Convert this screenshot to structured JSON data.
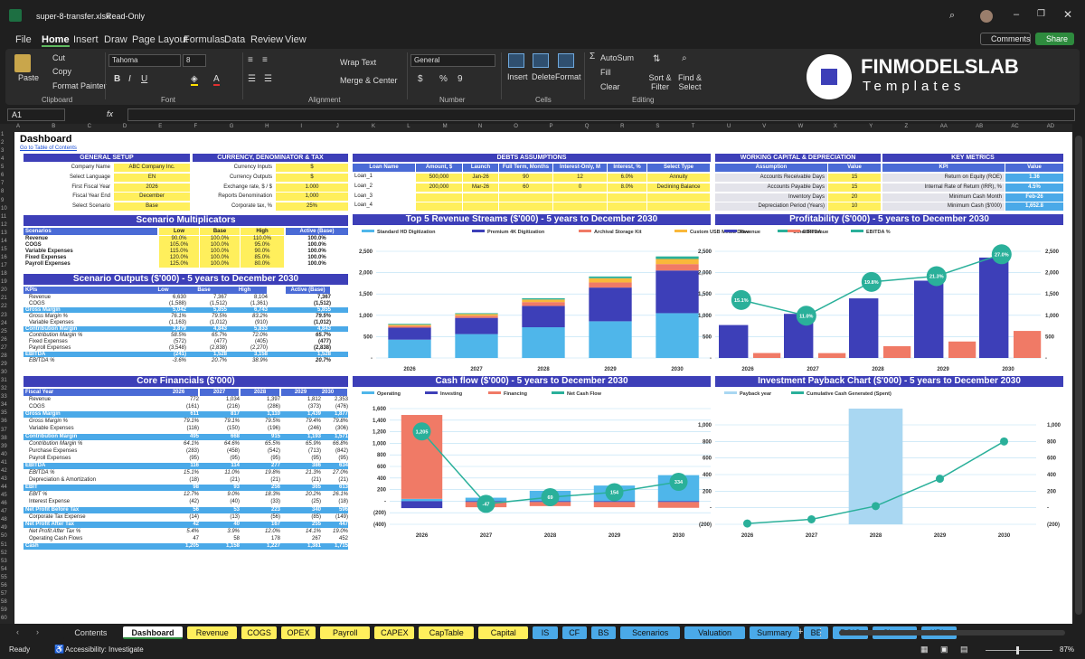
{
  "title": {
    "file": "super-8-transfer.xlsx",
    "mode": "Read-Only"
  },
  "menu": [
    "File",
    "Home",
    "Insert",
    "Draw",
    "Page Layout",
    "Formulas",
    "Data",
    "Review",
    "View"
  ],
  "actions": {
    "comments": "Comments",
    "share": "Share"
  },
  "ribbon": {
    "paste": "Paste",
    "cut": "Cut",
    "copy": "Copy",
    "format_painter": "Format Painter",
    "clipboard": "Clipboard",
    "font_name": "Tahoma",
    "font_size": "8",
    "font": "Font",
    "wrap": "Wrap Text",
    "merge": "Merge & Center",
    "alignment": "Alignment",
    "number_format": "General",
    "number": "Number",
    "insert": "Insert",
    "delete": "Delete",
    "format": "Format",
    "cells": "Cells",
    "autosum": "AutoSum",
    "fill": "Fill",
    "clear": "Clear",
    "sort": "Sort & Filter",
    "find": "Find & Select",
    "editing": "Editing"
  },
  "brand": {
    "name": "FINMODELSLAB",
    "sub": "Templates"
  },
  "formula": {
    "cell": "A1",
    "fx": "fx"
  },
  "columns": [
    "A",
    "B",
    "C",
    "D",
    "E",
    "F",
    "G",
    "H",
    "I",
    "J",
    "K",
    "L",
    "M",
    "N",
    "O",
    "P",
    "Q",
    "R",
    "S",
    "T",
    "U",
    "V",
    "W",
    "X",
    "Y",
    "Z",
    "AA",
    "AB",
    "AC",
    "AD"
  ],
  "sheet": {
    "title": "Dashboard",
    "link": "Go to Table of Contents",
    "general": {
      "header": "GENERAL SETUP",
      "rows": [
        [
          "Company Name",
          "ABC Company Inc."
        ],
        [
          "Select Language",
          "EN"
        ],
        [
          "First Fiscal Year",
          "2026"
        ],
        [
          "Fiscal Year End",
          "December"
        ],
        [
          "Select Scenario",
          "Base"
        ]
      ]
    },
    "currency": {
      "header": "CURRENCY, DENOMINATOR & TAX",
      "rows": [
        [
          "Currency Inputs",
          "$"
        ],
        [
          "Currency Outputs",
          "$"
        ],
        [
          "Exchange rate, $ / $",
          "1.000"
        ],
        [
          "Reports Denomination",
          "1,000"
        ],
        [
          "Corporate tax, %",
          "25%"
        ]
      ]
    },
    "debts": {
      "header": "DEBTS ASSUMPTIONS",
      "cols": [
        "Loan Name",
        "Amount, $",
        "Launch",
        "Full Term, Months",
        "Interest-Only, M",
        "Interest, %",
        "Select Type"
      ],
      "rows": [
        [
          "Loan_1",
          "500,000",
          "Jan-26",
          "90",
          "12",
          "6.0%",
          "Annuity"
        ],
        [
          "Loan_2",
          "200,000",
          "Mar-26",
          "60",
          "0",
          "8.0%",
          "Declining Balance"
        ],
        [
          "Loan_3",
          "",
          "",
          "",
          "",
          "",
          ""
        ],
        [
          "Loan_4",
          "",
          "",
          "",
          "",
          "",
          ""
        ]
      ]
    },
    "wc": {
      "header": "WORKING CAPITAL & DEPRECIATION",
      "cols": [
        "Assumption",
        "Value"
      ],
      "rows": [
        [
          "Accounts Receivable Days",
          "15"
        ],
        [
          "Accounts Payable Days",
          "15"
        ],
        [
          "Inventory Days",
          "20"
        ],
        [
          "Depreciation Period (Years)",
          "10"
        ]
      ]
    },
    "kpi": {
      "header": "KEY METRICS",
      "cols": [
        "KPI",
        "Value"
      ],
      "rows": [
        [
          "Return on Equity (ROE)",
          "1.36"
        ],
        [
          "Internal Rate of Return (IRR), %",
          "4.5%"
        ],
        [
          "Minimum Cash Month",
          "Feb-26"
        ],
        [
          "Minimum Cash ($'000)",
          "1,652.8"
        ]
      ]
    },
    "scenario": {
      "header": "Scenario Multiplicators",
      "cols": [
        "Scenarios",
        "Low",
        "Base",
        "High",
        "Active (Base)"
      ],
      "rows": [
        [
          "Revenue",
          "90.0%",
          "100.0%",
          "110.0%",
          "100.0%"
        ],
        [
          "COGS",
          "105.0%",
          "100.0%",
          "95.0%",
          "100.0%"
        ],
        [
          "Variable Expenses",
          "115.0%",
          "100.0%",
          "90.0%",
          "100.0%"
        ],
        [
          "Fixed Expenses",
          "120.0%",
          "100.0%",
          "85.0%",
          "100.0%"
        ],
        [
          "Payroll Expenses",
          "125.0%",
          "100.0%",
          "80.0%",
          "100.0%"
        ]
      ]
    },
    "outputs": {
      "header": "Scenario Outputs ($'000) - 5 years to December 2030",
      "cols": [
        "KPIs",
        "Low",
        "Base",
        "High",
        "Active (Base)"
      ],
      "rows": [
        [
          "Revenue",
          "6,630",
          "7,367",
          "8,104",
          "7,367",
          "n"
        ],
        [
          "COGS",
          "(1,588)",
          "(1,512)",
          "(1,361)",
          "(1,512)",
          "n"
        ],
        [
          "Gross Margin",
          "5,042",
          "5,855",
          "6,743",
          "5,855",
          "h"
        ],
        [
          "Gross Margin %",
          "76.1%",
          "79.5%",
          "83.2%",
          "79.5%",
          "i"
        ],
        [
          "Variable Expenses",
          "(1,163)",
          "(1,012)",
          "(910)",
          "(1,012)",
          "n"
        ],
        [
          "Contribution Margin",
          "3,879",
          "4,843",
          "5,833",
          "4,843",
          "h"
        ],
        [
          "Contribution Margin %",
          "58.5%",
          "65.7%",
          "72.0%",
          "65.7%",
          "i"
        ],
        [
          "Fixed Expenses",
          "(572)",
          "(477)",
          "(405)",
          "(477)",
          "n"
        ],
        [
          "Payroll Expenses",
          "(3,548)",
          "(2,838)",
          "(2,270)",
          "(2,838)",
          "n"
        ],
        [
          "EBITDA",
          "(241)",
          "1,528",
          "3,158",
          "1,528",
          "h"
        ],
        [
          "EBITDA %",
          "-3.6%",
          "20.7%",
          "38.9%",
          "20.7%",
          "i"
        ]
      ]
    },
    "core": {
      "header": "Core Financials ($'000)",
      "cols": [
        "Fiscal Year",
        "2026",
        "2027",
        "2028",
        "2029",
        "2030"
      ],
      "rows": [
        [
          "Revenue",
          "772",
          "1,034",
          "1,397",
          "1,812",
          "2,353",
          "n"
        ],
        [
          "COGS",
          "(161)",
          "(216)",
          "(286)",
          "(373)",
          "(476)",
          "n"
        ],
        [
          "Gross Margin",
          "611",
          "817",
          "1,110",
          "1,439",
          "1,877",
          "h"
        ],
        [
          "Gross Margin %",
          "79.1%",
          "79.1%",
          "79.5%",
          "79.4%",
          "79.8%",
          "i"
        ],
        [
          "Variable Expenses",
          "(116)",
          "(150)",
          "(196)",
          "(246)",
          "(306)",
          "n"
        ],
        [
          "Contribution Margin",
          "495",
          "668",
          "915",
          "1,193",
          "1,571",
          "h"
        ],
        [
          "Contribution Margin %",
          "64.1%",
          "64.6%",
          "65.5%",
          "65.9%",
          "66.8%",
          "i"
        ],
        [
          "Purchase Expenses",
          "(283)",
          "(458)",
          "(542)",
          "(713)",
          "(842)",
          "n"
        ],
        [
          "Payroll Expenses",
          "(95)",
          "(95)",
          "(95)",
          "(95)",
          "(95)",
          "n"
        ],
        [
          "EBITDA",
          "116",
          "114",
          "277",
          "386",
          "634",
          "h"
        ],
        [
          "EBITDA %",
          "15.1%",
          "11.0%",
          "19.8%",
          "21.3%",
          "27.0%",
          "i"
        ],
        [
          "Depreciation & Amortization",
          "(18)",
          "(21)",
          "(21)",
          "(21)",
          "(21)",
          "n"
        ],
        [
          "EBIT",
          "98",
          "93",
          "256",
          "365",
          "613",
          "h"
        ],
        [
          "EBIT %",
          "12.7%",
          "9.0%",
          "18.3%",
          "20.2%",
          "26.1%",
          "i"
        ],
        [
          "Interest Expense",
          "(42)",
          "(40)",
          "(33)",
          "(25)",
          "(18)",
          "n"
        ],
        [
          "Net Profit Before Tax",
          "56",
          "53",
          "223",
          "340",
          "596",
          "h"
        ],
        [
          "Corporate Tax Expense",
          "(14)",
          "(13)",
          "(56)",
          "(85)",
          "(149)",
          "n"
        ],
        [
          "Net Profit After Tax",
          "42",
          "40",
          "167",
          "255",
          "447",
          "h"
        ],
        [
          "Net Profit After Tax %",
          "5.4%",
          "3.9%",
          "12.0%",
          "14.1%",
          "19.0%",
          "i"
        ],
        [
          "Operating Cash Flows",
          "47",
          "58",
          "178",
          "267",
          "452",
          "n"
        ],
        [
          "Cash",
          "1,205",
          "1,158",
          "1,227",
          "1,381",
          "1,715",
          "h"
        ]
      ]
    }
  },
  "chart_data": [
    {
      "type": "bar",
      "title": "Top 5 Revenue Streams ($'000) - 5 years to December 2030",
      "categories": [
        "2026",
        "2027",
        "2028",
        "2029",
        "2030"
      ],
      "series": [
        {
          "name": "Standard HD Digitization",
          "color": "#4fb6ea",
          "values": [
            430,
            560,
            720,
            860,
            1050
          ]
        },
        {
          "name": "Premium 4K Digitization",
          "color": "#3d3fb8",
          "values": [
            280,
            380,
            500,
            790,
            1000
          ]
        },
        {
          "name": "Archival Storage Kit",
          "color": "#f07a66",
          "values": [
            40,
            50,
            90,
            120,
            150
          ]
        },
        {
          "name": "Custom USB Media Drive",
          "color": "#f9b83a",
          "values": [
            30,
            40,
            60,
            100,
            120
          ]
        },
        {
          "name": "Other Revenue",
          "color": "#2ab09a",
          "values": [
            20,
            20,
            30,
            40,
            60
          ]
        }
      ],
      "ylim": [
        0,
        2500
      ],
      "yticks": [
        "2,500",
        "2,000",
        "1,500",
        "1,000",
        "500",
        "-"
      ]
    },
    {
      "type": "bar",
      "title": "Profitability ($'000) - 5 years to December 2030",
      "categories": [
        "2026",
        "2027",
        "2028",
        "2029",
        "2030"
      ],
      "series": [
        {
          "name": "Revenue",
          "color": "#3d3fb8",
          "values": [
            772,
            1034,
            1397,
            1812,
            2353
          ]
        },
        {
          "name": "EBITDA",
          "color": "#f07a66",
          "values": [
            116,
            114,
            277,
            386,
            634
          ]
        },
        {
          "name": "EBITDA %",
          "color": "#2ab09a",
          "values": [
            15.1,
            11.0,
            19.8,
            21.3,
            27.0
          ]
        }
      ],
      "labels": [
        "15.1%",
        "11.0%",
        "19.8%",
        "21.3%",
        "27.0%"
      ],
      "ylim": [
        0,
        2500
      ],
      "yticks": [
        "2,500",
        "2,000",
        "1,500",
        "1,000",
        "500",
        "-"
      ]
    },
    {
      "type": "bar",
      "title": "Cash flow ($'000) - 5 years to December 2030",
      "categories": [
        "2026",
        "2027",
        "2028",
        "2029",
        "2030"
      ],
      "series": [
        {
          "name": "Operating",
          "color": "#4fb6ea",
          "values": [
            40,
            60,
            180,
            270,
            450
          ]
        },
        {
          "name": "Investing",
          "color": "#3d3fb8",
          "values": [
            -120,
            -15,
            -15,
            -15,
            -15
          ]
        },
        {
          "name": "Financing",
          "color": "#f07a66",
          "values": [
            1450,
            -90,
            -70,
            -90,
            -100
          ]
        },
        {
          "name": "Net Cash Flow",
          "color": "#2ab09a",
          "values": [
            1205,
            -47,
            69,
            154,
            334
          ]
        }
      ],
      "labels": [
        "1,205",
        "-47",
        "69",
        "154",
        "334"
      ],
      "ylim": [
        -400,
        1600
      ],
      "yticks": [
        "1,600",
        "1,400",
        "1,200",
        "1,000",
        "800",
        "600",
        "400",
        "200",
        "-",
        "(200)",
        "(400)"
      ]
    },
    {
      "type": "line",
      "title": "Investment Payback Chart ($'000) - 5 years to December 2030",
      "categories": [
        "2026",
        "2027",
        "2028",
        "2029",
        "2030"
      ],
      "series": [
        {
          "name": "Payback year",
          "color": "#a9d7f2",
          "values": [
            0,
            0,
            1,
            0,
            0
          ]
        },
        {
          "name": "Cumulative Cash Generated (Spent)",
          "color": "#2ab09a",
          "values": [
            -190,
            -140,
            20,
            350,
            800
          ]
        }
      ],
      "ylim": [
        -200,
        1000
      ],
      "yticks": [
        "1,000",
        "800",
        "600",
        "400",
        "200",
        "-",
        "(200)"
      ]
    }
  ],
  "tabs": [
    "Contents",
    "Dashboard",
    "Revenue",
    "COGS",
    "OPEX",
    "Payroll",
    "CAPEX",
    "CapTable",
    "Capital",
    "IS",
    "CF",
    "BS",
    "Scenarios",
    "Valuation",
    "Summary",
    "BE",
    "ROIC",
    "Charts",
    "KPIs"
  ],
  "status": {
    "ready": "Ready",
    "access": "Accessibility: Investigate",
    "zoom": "87%"
  }
}
